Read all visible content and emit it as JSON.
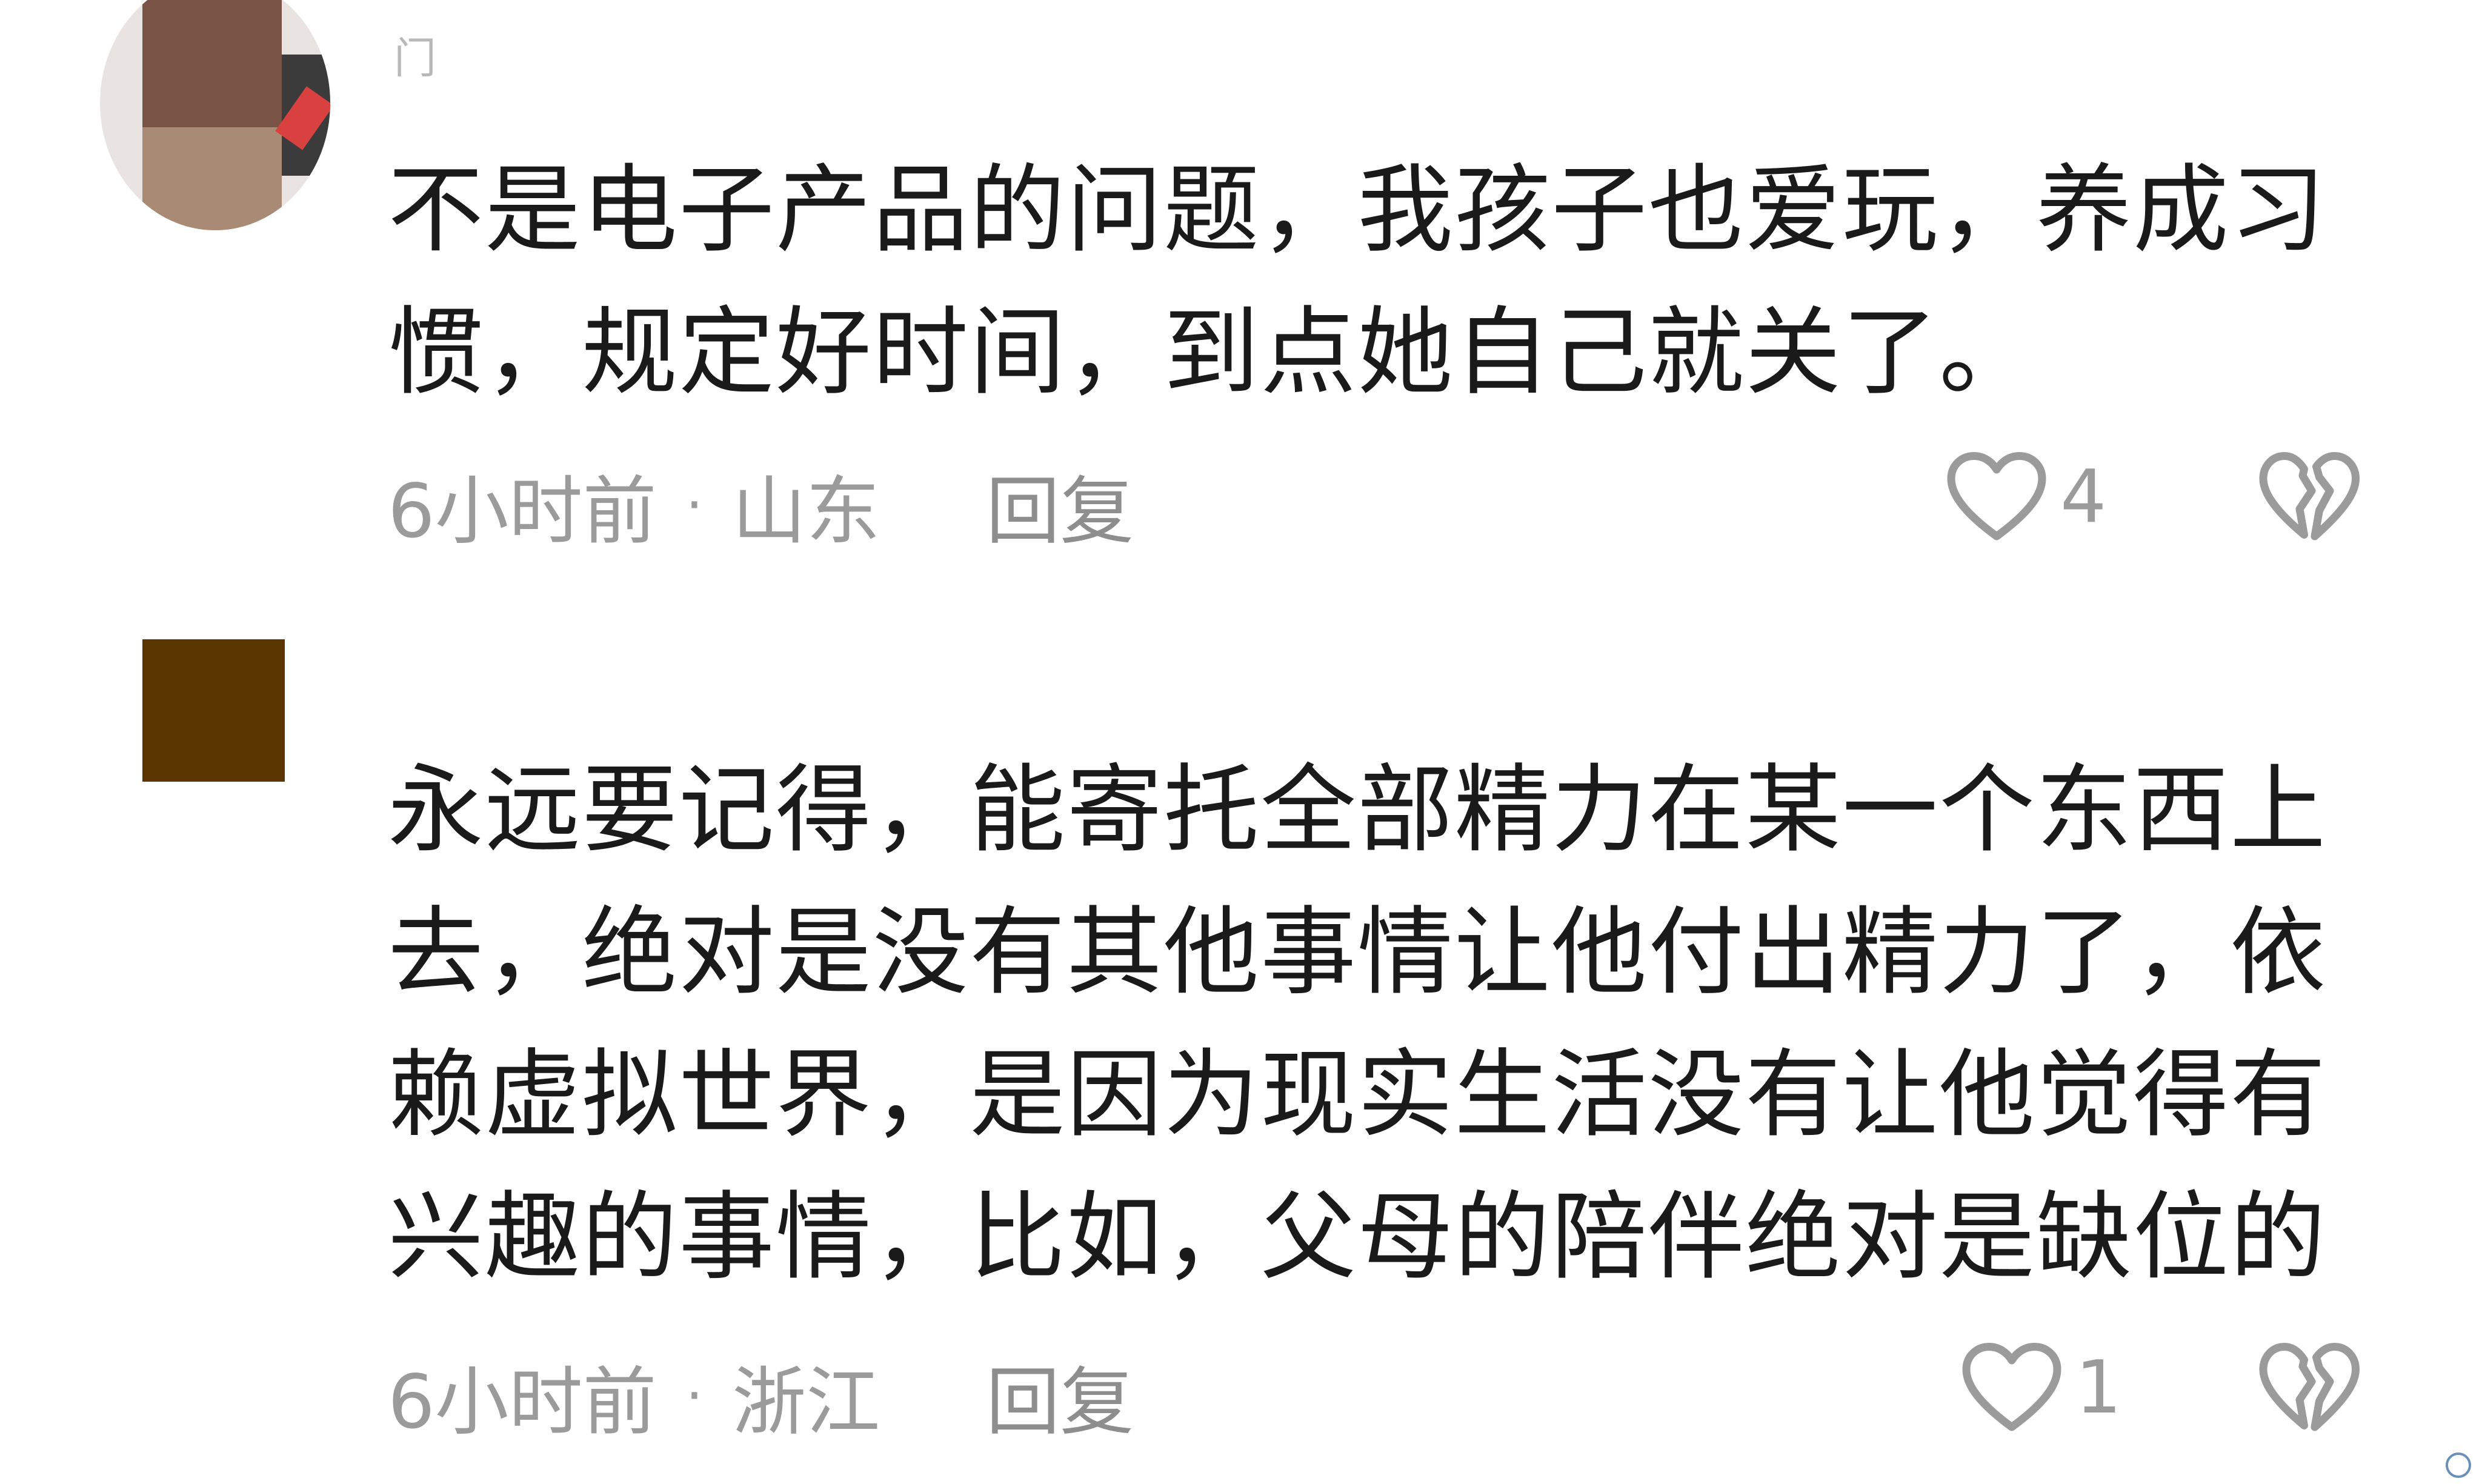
{
  "comments": [
    {
      "username": "门",
      "text": "不是电子产品的问题，我孩子也爱玩，养成习惯，规定好时间，到点她自己就关了。",
      "time": "6小时前",
      "separator": "·",
      "location": "山东",
      "reply_label": "回复",
      "like_count": "4",
      "like_icon": "heart-outline-icon",
      "dislike_icon": "broken-heart-icon"
    },
    {
      "username": "",
      "text": "永远要记得，能寄托全部精力在某一个东西上去，绝对是没有其他事情让他付出精力了，依赖虚拟世界，是因为现实生活没有让他觉得有兴趣的事情，比如，父母的陪伴绝对是缺位的",
      "time": "6小时前",
      "separator": "·",
      "location": "浙江",
      "reply_label": "回复",
      "like_count": "1",
      "like_icon": "heart-outline-icon",
      "dislike_icon": "broken-heart-icon"
    }
  ],
  "colors": {
    "text": "#1a1a1a",
    "meta": "#9b9b9b",
    "icon": "#9b9b9b",
    "avatar_square": "#5c3600"
  }
}
